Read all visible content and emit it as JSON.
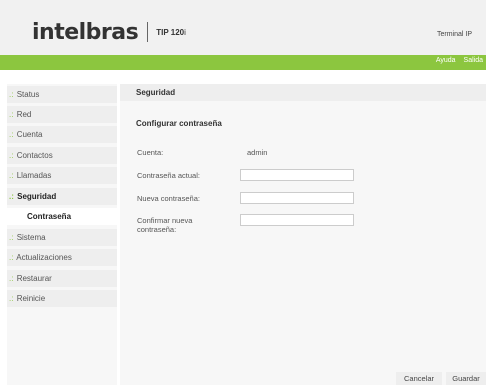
{
  "header": {
    "brand": "intelbras",
    "model": "TIP 120",
    "model_suffix": "i",
    "device": "Terminal IP"
  },
  "topnav": {
    "help": "Ayuda",
    "exit": "Salida"
  },
  "sidebar": {
    "bullet": ".:",
    "items": [
      {
        "label": "Status"
      },
      {
        "label": "Red"
      },
      {
        "label": "Cuenta"
      },
      {
        "label": "Contactos"
      },
      {
        "label": "Llamadas"
      },
      {
        "label": "Seguridad"
      },
      {
        "label": "Contraseña"
      },
      {
        "label": "Sistema"
      },
      {
        "label": "Actualizaciones"
      },
      {
        "label": "Restaurar"
      },
      {
        "label": "Reinicie"
      }
    ]
  },
  "page": {
    "title": "Seguridad",
    "subtitle": "Configurar contraseña",
    "account_label": "Cuenta:",
    "account_value": "admin",
    "current_label": "Contraseña actual:",
    "new_label": "Nueva contraseña:",
    "confirm_label": "Confirmar nueva contraseña:"
  },
  "buttons": {
    "cancel": "Cancelar",
    "save": "Guardar"
  },
  "colors": {
    "accent": "#8cc63f",
    "header_bg": "#f1f1f1",
    "panel_bg": "#eeeeee"
  }
}
